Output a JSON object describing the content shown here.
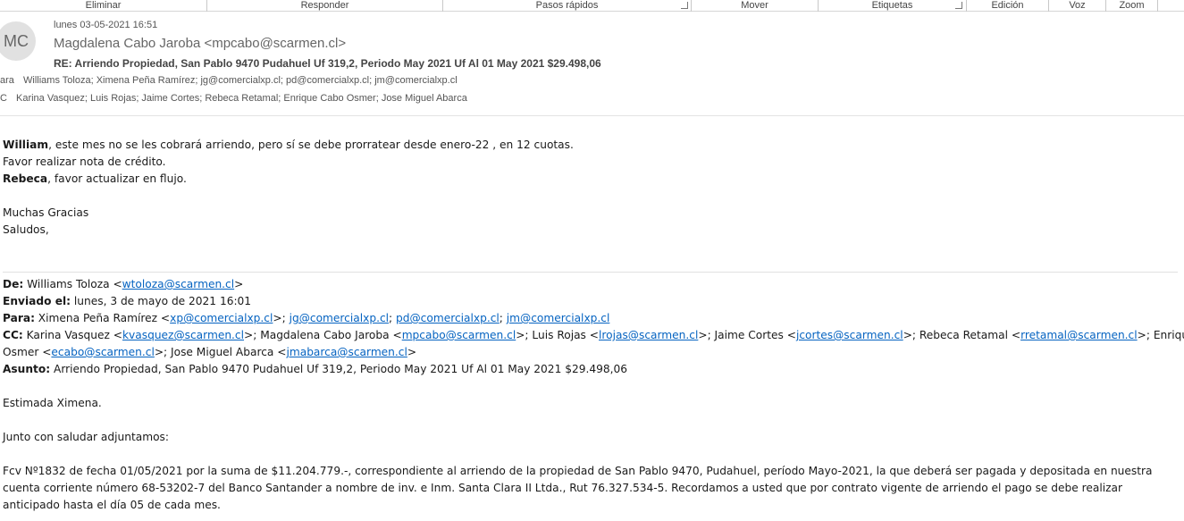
{
  "ribbon": {
    "groups": [
      "Eliminar",
      "Responder",
      "Pasos rápidos",
      "Mover",
      "Etiquetas",
      "Edición",
      "Voz",
      "Zoom"
    ]
  },
  "header": {
    "avatar_initials": "MC",
    "date": "lunes 03-05-2021 16:51",
    "from": "Magdalena Cabo Jaroba <mpcabo@scarmen.cl>",
    "subject": "RE: Arriendo Propiedad, San Pablo 9470 Pudahuel Uf 319,2, Periodo May 2021 Uf Al 01 May 2021 $29.498,06",
    "to_label": "ara",
    "to": "Williams Toloza; Ximena Peña Ramírez; jg@comercialxp.cl; pd@comercialxp.cl; jm@comercialxp.cl",
    "cc_label": "C",
    "cc": "Karina Vasquez; Luis Rojas; Jaime Cortes; Rebeca Retamal; Enrique Cabo Osmer; Jose Miguel Abarca"
  },
  "reply": {
    "l1_name": "William",
    "l1_rest": ", este mes no se les cobrará arriendo, pero sí se debe prorratear desde enero-22 , en 12 cuotas.",
    "l2": "Favor realizar nota de crédito.",
    "l3_name": "Rebeca",
    "l3_rest": ", favor actualizar en flujo.",
    "thanks": "Muchas Gracias",
    "regards": "Saludos,"
  },
  "quoted": {
    "de_label": "De:",
    "de_name": " Williams Toloza <",
    "de_email": "wtoloza@scarmen.cl",
    "de_close": ">",
    "sent_label": "Enviado el:",
    "sent": " lunes, 3 de mayo de 2021 16:01",
    "para_label": "Para:",
    "para_name": " Ximena Peña Ramírez <",
    "para_e1": "xp@comercialxp.cl",
    "para_e2": "jg@comercialxp.cl",
    "para_e3": "pd@comercialxp.cl",
    "para_e4": "jm@comercialxp.cl",
    "cc_label": "CC:",
    "cc_1": " Karina Vasquez <",
    "cc_e1": "kvasquez@scarmen.cl",
    "cc_2": ">; Magdalena Cabo Jaroba <",
    "cc_e2": "mpcabo@scarmen.cl",
    "cc_3": ">; Luis Rojas <",
    "cc_e3": "lrojas@scarmen.cl",
    "cc_4": ">; Jaime Cortes <",
    "cc_e4": "jcortes@scarmen.cl",
    "cc_5": ">; Rebeca Retamal <",
    "cc_e5": "rretamal@scarmen.cl",
    "cc_6": ">; Enrique Cabo",
    "cc_7": "Osmer <",
    "cc_e6": "ecabo@scarmen.cl",
    "cc_8": ">; Jose Miguel Abarca <",
    "cc_e7": "jmabarca@scarmen.cl",
    "cc_9": ">",
    "asunto_label": "Asunto:",
    "asunto": " Arriendo Propiedad, San Pablo 9470 Pudahuel Uf 319,2, Periodo May 2021 Uf Al 01 May 2021 $29.498,06",
    "greeting": "Estimada Ximena.",
    "intro": "Junto con saludar adjuntamos:",
    "paragraph": "Fcv Nº1832 de fecha 01/05/2021 por la suma de $11.204.779.-, correspondiente al arriendo de la propiedad de San Pablo 9470, Pudahuel, período Mayo-2021,  la que deberá ser pagada y depositada en nuestra cuenta corriente número 68-53202-7 del Banco Santander a nombre de inv. e Inm. Santa Clara II Ltda., Rut 76.327.534-5. Recordamos a usted que por contrato vigente de arriendo el pago se debe realizar anticipado hasta el día 05 de cada mes."
  }
}
